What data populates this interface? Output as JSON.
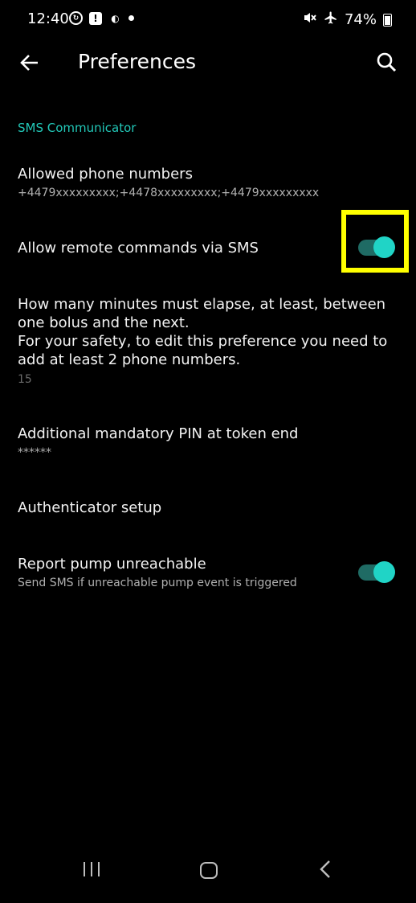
{
  "status_bar": {
    "time": "12:40",
    "battery": "74%",
    "icons_left": [
      "sync-icon",
      "alert-icon",
      "half-circle-icon",
      "dot-icon"
    ],
    "icons_right": [
      "mute-icon",
      "airplane-icon",
      "battery-icon"
    ]
  },
  "app_bar": {
    "title": "Preferences",
    "back_icon": "arrow-left-icon",
    "search_icon": "search-icon"
  },
  "category": "SMS Communicator",
  "prefs": [
    {
      "title": "Allowed phone numbers",
      "summary": "+4479xxxxxxxxx;+4478xxxxxxxxx;+4479xxxxxxxxx"
    },
    {
      "title": "Allow remote commands via SMS",
      "toggle": true
    },
    {
      "title": "How many minutes must elapse, at least, between one bolus and the next.\nFor your safety, to edit this preference you need to add at least 2 phone numbers.",
      "summary": "15"
    },
    {
      "title": "Additional mandatory PIN at token end",
      "summary": "******"
    },
    {
      "title": "Authenticator setup"
    },
    {
      "title": "Report pump unreachable",
      "summary": "Send SMS if unreachable pump event is triggered",
      "toggle": true
    }
  ],
  "colors": {
    "accent": "#20d4c6",
    "track": "#1f6b64",
    "highlight": "#ffff00",
    "category": "#22c8b8"
  },
  "nav_bar": {
    "icons": [
      "recents-icon",
      "home-icon",
      "back-icon"
    ]
  }
}
